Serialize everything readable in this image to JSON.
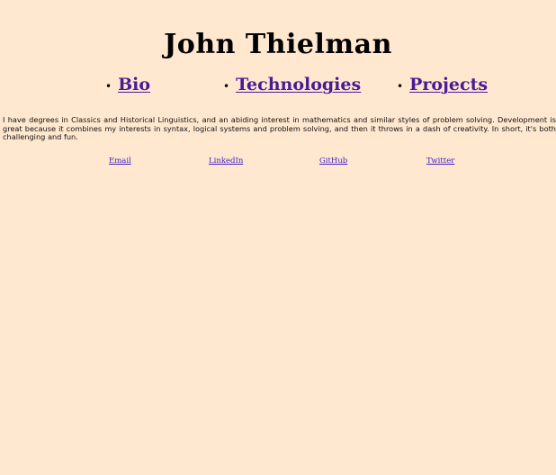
{
  "site": {
    "title": "John Thielman"
  },
  "nav": {
    "items": [
      {
        "label": "Bio"
      },
      {
        "label": "Technologies"
      },
      {
        "label": "Projects"
      }
    ]
  },
  "intro": {
    "text": "I have degrees in Classics and Historical Linguistics, and an abiding interest in mathematics and similar styles of problem solving. Development is great because it combines my interests in syntax, logical systems and problem solving, and then it throws in a dash of creativity. In short, it's both challenging and fun."
  },
  "links": {
    "email": "Email",
    "linkedin": "LinkedIn",
    "github": "GitHub",
    "twitter": "Twitter"
  },
  "colors": {
    "background": "#ffe8cf",
    "nav_link": "#4b1a96",
    "footer_link": "#3f22c8"
  }
}
